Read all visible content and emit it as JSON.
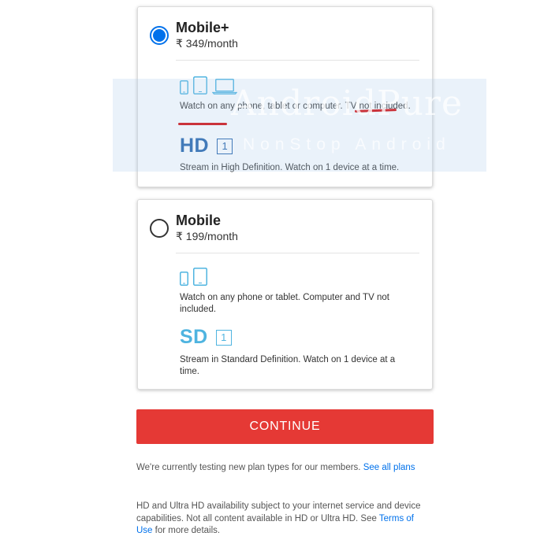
{
  "plans": [
    {
      "name": "Mobile+",
      "price": "₹ 349/month",
      "selected": true,
      "devices_text": "Watch on any phone, tablet or computer. TV not included.",
      "quality": "HD",
      "screens": "1",
      "stream_text": "Stream in High Definition. Watch on 1 device at a time.",
      "device_icons": [
        "phone-icon",
        "tablet-icon",
        "laptop-icon"
      ]
    },
    {
      "name": "Mobile",
      "price": "₹ 199/month",
      "selected": false,
      "devices_text": "Watch on any phone or tablet. Computer and TV not included.",
      "quality": "SD",
      "screens": "1",
      "stream_text": "Stream in Standard Definition. Watch on 1 device at a time.",
      "device_icons": [
        "phone-icon",
        "tablet-icon"
      ]
    }
  ],
  "continue_label": "CONTINUE",
  "notes": {
    "testing_text": "We're currently testing new plan types for our members. ",
    "see_all_link": "See all plans",
    "availability_text": "HD and Ultra HD availability subject to your internet service and device capabilities. Not all content available in HD or Ultra HD. See ",
    "terms_link": "Terms of Use",
    "availability_suffix": " for more details."
  },
  "watermark": {
    "title": "AndroidPure",
    "subtitle": "NonStop Android"
  },
  "colors": {
    "selected_radio": "#0071eb",
    "continue_button": "#e53935",
    "hd_label": "#1f5fa8",
    "sd_label": "#4fb4e0",
    "annotation_underline": "#d50000"
  }
}
